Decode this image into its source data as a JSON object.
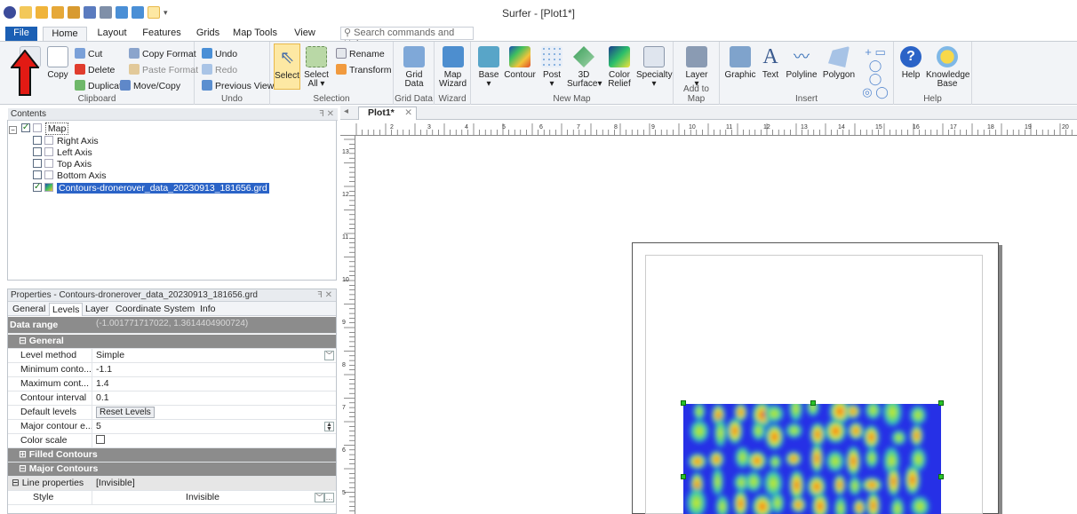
{
  "window": {
    "title": "Surfer - [Plot1*]"
  },
  "ribbon_tabs": [
    "File",
    "Home",
    "Layout",
    "Features",
    "Grids",
    "Map Tools",
    "View"
  ],
  "search": {
    "placeholder": "Search commands and Help..."
  },
  "clipboard": {
    "copy": "Copy",
    "cut": "Cut",
    "delete": "Delete",
    "duplicate": "Duplicate",
    "copy_format": "Copy Format",
    "paste_format": "Paste Format",
    "move_copy": "Move/Copy",
    "label": "Clipboard"
  },
  "undo_group": {
    "undo": "Undo",
    "redo": "Redo",
    "previous_view": "Previous View",
    "label": "Undo"
  },
  "selection_group": {
    "select": "Select",
    "select_all_1": "Select",
    "select_all_2": "All",
    "rename": "Rename",
    "transform": "Transform",
    "label": "Selection"
  },
  "grid_data_group": {
    "btn1": "Grid",
    "btn2": "Data",
    "label": "Grid Data"
  },
  "wizard_group": {
    "btn1": "Map",
    "btn2": "Wizard",
    "label": "Wizard"
  },
  "new_map_group": {
    "base": "Base",
    "contour": "Contour",
    "post": "Post",
    "surface_1": "3D",
    "surface_2": "Surface",
    "relief_1": "Color",
    "relief_2": "Relief",
    "specialty": "Specialty",
    "label": "New Map"
  },
  "add_to_map_group": {
    "layer": "Layer",
    "label": "Add to Map"
  },
  "insert_group": {
    "graphic": "Graphic",
    "text": "Text",
    "polyline": "Polyline",
    "polygon": "Polygon",
    "label": "Insert"
  },
  "help_group": {
    "help": "Help",
    "kb_1": "Knowledge",
    "kb_2": "Base",
    "label": "Help"
  },
  "contents": {
    "title": "Contents",
    "items": [
      {
        "label": "Map",
        "checked": true
      },
      {
        "label": "Right Axis",
        "checked": false
      },
      {
        "label": "Left Axis",
        "checked": false
      },
      {
        "label": "Top Axis",
        "checked": false
      },
      {
        "label": "Bottom Axis",
        "checked": false
      },
      {
        "label": "Contours-dronerover_data_20230913_181656.grd",
        "checked": true
      }
    ]
  },
  "properties": {
    "title": "Properties - Contours-dronerover_data_20230913_181656.grd",
    "tabs": [
      "General",
      "Levels",
      "Layer",
      "Coordinate System",
      "Info"
    ],
    "data_range_label": "Data range",
    "data_range_value": "(-1.001771717022, 1.3614404900724)",
    "general_section": "General",
    "rows": [
      {
        "key": "Level method",
        "value": "Simple"
      },
      {
        "key": "Minimum conto...",
        "value": "-1.1"
      },
      {
        "key": "Maximum cont...",
        "value": "1.4"
      },
      {
        "key": "Contour interval",
        "value": "0.1"
      },
      {
        "key": "Default levels",
        "value": "Reset Levels"
      },
      {
        "key": "Major contour e...",
        "value": "5"
      },
      {
        "key": "Color scale",
        "value": ""
      }
    ],
    "filled_section": "Filled Contours",
    "major_section": "Major Contours",
    "line_props_key": "Line properties",
    "line_props_value": "[Invisible]",
    "style_key": "Style",
    "style_value": "Invisible"
  },
  "document": {
    "tab": "Plot1*"
  },
  "ruler": {
    "h_labels": [
      "2",
      "3",
      "4",
      "5",
      "6",
      "7",
      "8",
      "9",
      "10",
      "11",
      "12",
      "13",
      "14",
      "15",
      "16",
      "17",
      "18",
      "19",
      "20"
    ],
    "v_labels": [
      "13",
      "12",
      "11",
      "10",
      "9",
      "8",
      "7",
      "6",
      "5"
    ]
  },
  "colors": {
    "file_tab": "#1b5fb4",
    "selection": "#2a63c7",
    "accent_select": "#fde8a3"
  }
}
